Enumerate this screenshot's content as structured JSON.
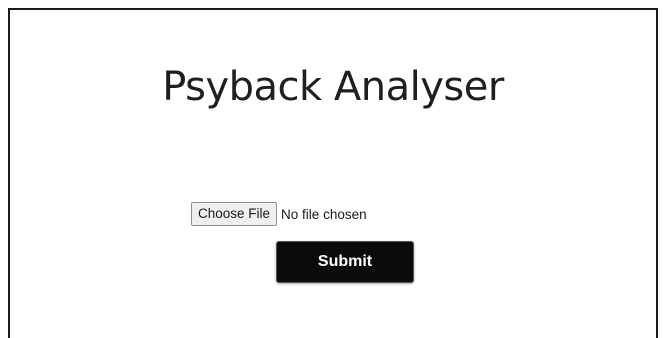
{
  "page": {
    "title": "Psyback Analyser"
  },
  "upload": {
    "choose_label": "Choose File",
    "status": "No file chosen"
  },
  "form": {
    "submit_label": "Submit"
  },
  "colors": {
    "submit_bg": "#0b0b0b",
    "submit_text": "#ffffff",
    "frame_border": "#1a1a1a"
  }
}
